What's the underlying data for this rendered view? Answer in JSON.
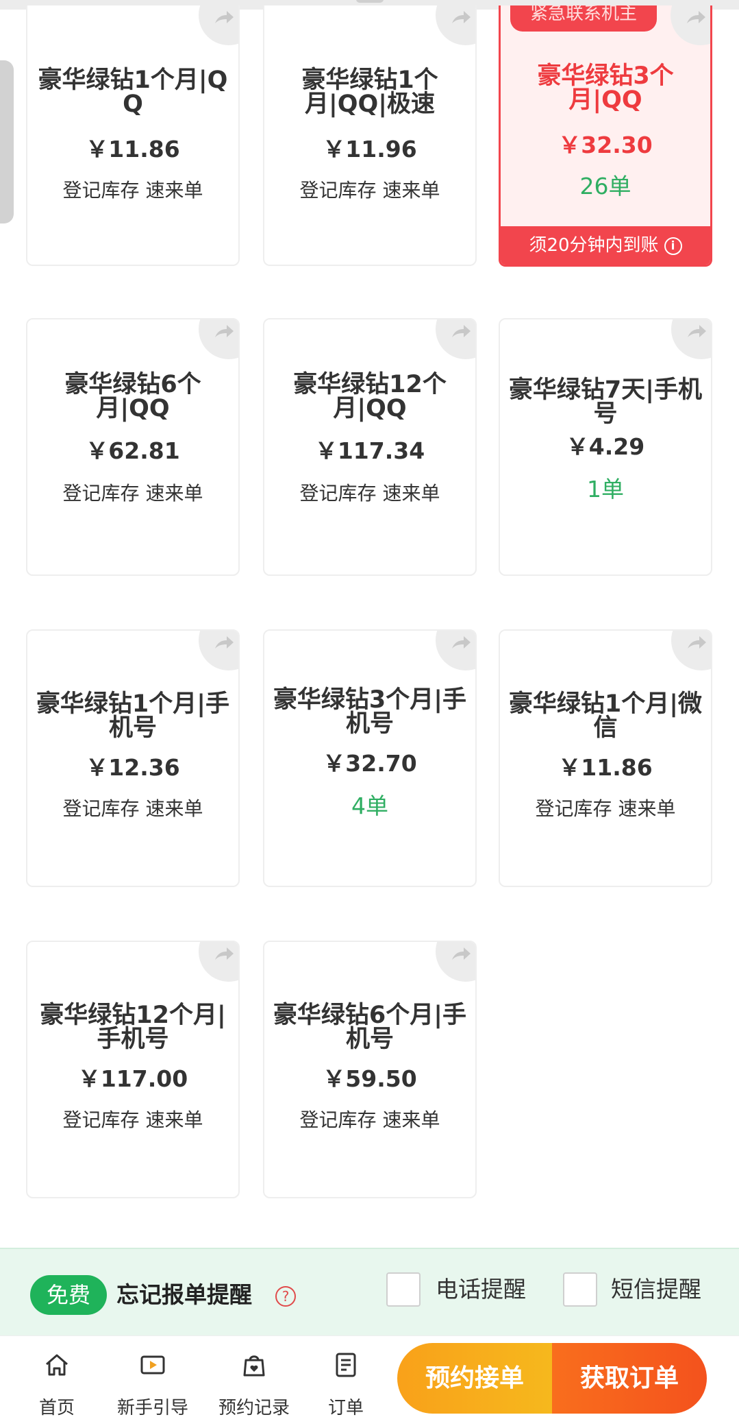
{
  "cards": [
    {
      "title": "豪华绿钻1个月|QQ",
      "price": "￥11.86",
      "status": "登记库存 速来单"
    },
    {
      "title": "豪华绿钻1个月|QQ|极速",
      "price": "￥11.96",
      "status": "登记库存 速来单"
    },
    {
      "title": "豪华绿钻3个月|QQ",
      "price": "￥32.30",
      "status": "26单",
      "tag": "紧急联系机主",
      "banner": "须20分钟内到账",
      "info_glyph": "i"
    },
    {
      "title": "豪华绿钻6个月|QQ",
      "price": "￥62.81",
      "status": "登记库存 速来单"
    },
    {
      "title": "豪华绿钻12个月|QQ",
      "price": "￥117.34",
      "status": "登记库存 速来单"
    },
    {
      "title": "豪华绿钻7天|手机号",
      "price": "￥4.29",
      "status": "1单"
    },
    {
      "title": "豪华绿钻1个月|手机号",
      "price": "￥12.36",
      "status": "登记库存 速来单"
    },
    {
      "title": "豪华绿钻3个月|手机号",
      "price": "￥32.70",
      "status": "4单"
    },
    {
      "title": "豪华绿钻1个月|微信",
      "price": "￥11.86",
      "status": "登记库存 速来单"
    },
    {
      "title": "豪华绿钻12个月|手机号",
      "price": "￥117.00",
      "status": "登记库存 速来单"
    },
    {
      "title": "豪华绿钻6个月|手机号",
      "price": "￥59.50",
      "status": "登记库存 速来单"
    }
  ],
  "reminder": {
    "badge": "免费",
    "title": "忘记报单提醒",
    "help_glyph": "?",
    "phone_label": "电话提醒",
    "sms_label": "短信提醒"
  },
  "nav": {
    "home": "首页",
    "guide": "新手引导",
    "records": "预约记录",
    "orders": "订单"
  },
  "cta": {
    "reserve": "预约接单",
    "get_order": "获取订单"
  },
  "colors": {
    "accent_red": "#f2454d",
    "accent_green": "#1fb35a",
    "cta_orange": "#f9a11a",
    "cta_red": "#f4521d"
  }
}
